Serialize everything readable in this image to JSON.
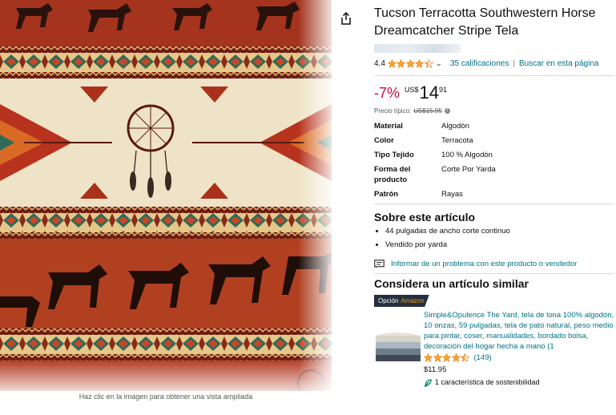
{
  "product": {
    "title": "Tucson Terracotta Southwestern Horse Dreamcatcher Stripe Tela",
    "rating_value": "4.4",
    "rating_stars": 4.4,
    "ratings_link": "35 calificaciones",
    "search_link": "Buscar en esta página",
    "separator": "|",
    "discount": "-7%",
    "price_currency": "US$",
    "price_whole": "14",
    "price_fraction": "91",
    "typical_label": "Precio típico:",
    "typical_price": "US$15.95",
    "image_caption": "Haz clic en la imagen para obtener una vista ampliada"
  },
  "specs": [
    {
      "label": "Material",
      "value": "Algodón"
    },
    {
      "label": "Color",
      "value": "Terracota"
    },
    {
      "label": "Tipo Tejido",
      "value": "100 % Algodón"
    },
    {
      "label": "Forma del producto",
      "value": "Corte Por Yarda"
    },
    {
      "label": "Patrón",
      "value": "Rayas"
    }
  ],
  "about": {
    "title": "Sobre este artículo",
    "bullets": [
      "44 pulgadas de ancho corte continuo",
      "Vendido por yarda"
    ]
  },
  "report_link": "Informar de un problema con este producto o vendedor",
  "similar": {
    "title": "Considera un artículo similar",
    "badge_option": "Opción",
    "badge_brand": "Amazon",
    "item_title": "Simple&Opulence The Yard, tela de lona 100% algodón, 10 onzas, 59 pulgadas, tela de pato natural, peso medio para pintar, coser, manualidades, bordado bolsa, decoración del hogar hecha a mano (1",
    "item_rating_stars": 4.5,
    "item_rating_count": "(149)",
    "item_price": "$11.95",
    "sustainability": "1 característica de sostenibilidad"
  },
  "colors": {
    "link": "#007185",
    "discount": "#cc0c39",
    "star": "#ffa41c",
    "badge_bg": "#232f3e",
    "badge_brand": "#ff9900"
  },
  "icons": [
    "share-icon",
    "chevron-down-icon",
    "info-icon",
    "report-icon",
    "leaf-icon",
    "star-icon"
  ]
}
